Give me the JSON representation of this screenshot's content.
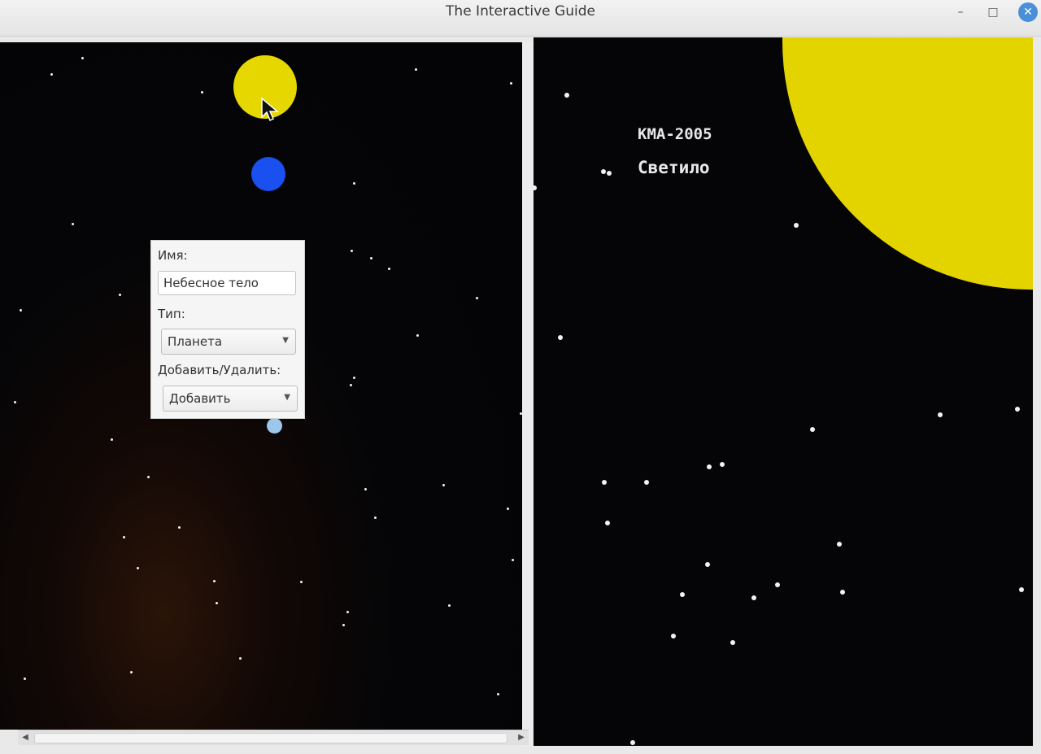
{
  "window": {
    "title": "The Interactive Guide",
    "minimize_glyph": "–",
    "maximize_glyph": "□",
    "close_glyph": "✕"
  },
  "dialog": {
    "name_label": "Имя:",
    "name_value": "Небесное тело",
    "type_label": "Тип:",
    "type_value": "Планета",
    "action_label": "Добавить/Удалить:",
    "action_value": "Добавить"
  },
  "detail": {
    "object_id": "КМА-2005",
    "object_type": "Светило"
  },
  "scrollbar": {
    "left_arrow": "◀",
    "right_arrow": "▶"
  },
  "colors": {
    "star_color": "#e6d700",
    "planet_blue": "#1a4ff0",
    "planet_pale": "#9cc6ea",
    "space": "#050507"
  },
  "icons": [
    "minimize-icon",
    "maximize-icon",
    "close-icon",
    "cursor-icon",
    "chevron-down-icon"
  ]
}
